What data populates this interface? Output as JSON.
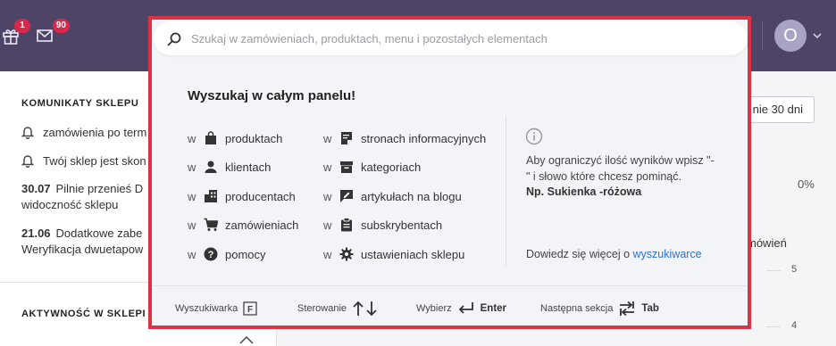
{
  "topbar": {
    "gift_badge": "1",
    "mail_badge": "90",
    "avatar_initial": "O"
  },
  "sidebar": {
    "section_title": "KOMUNIKATY SKLEPU",
    "messages": [
      {
        "text": "zamówienia po term"
      },
      {
        "text": "Twój sklep jest skon"
      }
    ],
    "news": [
      {
        "date": "30.07",
        "line1": "Pilnie przenieś D",
        "line2": "widoczność sklepu"
      },
      {
        "date": "21.06",
        "line1": "Dodatkowe zabe",
        "line2": "Weryfikacja dwuetapow"
      }
    ],
    "activity_title": "AKTYWNOŚĆ W SKLEPI"
  },
  "dashboard": {
    "period_button": "nie 30 dni",
    "percent": "0%",
    "orders_label": "mówień",
    "ticks": [
      "5",
      "4"
    ]
  },
  "search": {
    "placeholder": "Szukaj w zamówieniach, produktach, menu i pozostałych elementach",
    "heading": "Wyszukaj w całym panelu!",
    "prefix": "w",
    "col1": [
      {
        "label": "produktach",
        "icon": "bag-icon"
      },
      {
        "label": "klientach",
        "icon": "person-icon"
      },
      {
        "label": "producentach",
        "icon": "building-icon"
      },
      {
        "label": "zamówieniach",
        "icon": "cart-icon"
      },
      {
        "label": "pomocy",
        "icon": "help-icon"
      }
    ],
    "col2": [
      {
        "label": "stronach informacyjnych",
        "icon": "page-icon"
      },
      {
        "label": "kategoriach",
        "icon": "box-icon"
      },
      {
        "label": "artykułach na blogu",
        "icon": "blog-icon"
      },
      {
        "label": "subskrybentach",
        "icon": "clipboard-icon"
      },
      {
        "label": "ustawieniach sklepu",
        "icon": "gear-icon"
      }
    ],
    "info_text": "Aby ograniczyć ilość wyników wpisz \"-\" i słowo które chcesz pominąć.",
    "info_example": "Np. Sukienka -różowa",
    "more_text": "Dowiedz się więcej",
    "more_prefix": "o",
    "more_link": "wyszukiwarce",
    "shortcuts": {
      "search_label": "Wyszukiwarka",
      "search_key": "F",
      "nav_label": "Sterowanie",
      "select_label": "Wybierz",
      "select_key": "Enter",
      "next_label": "Następna sekcja",
      "next_key": "Tab"
    }
  }
}
